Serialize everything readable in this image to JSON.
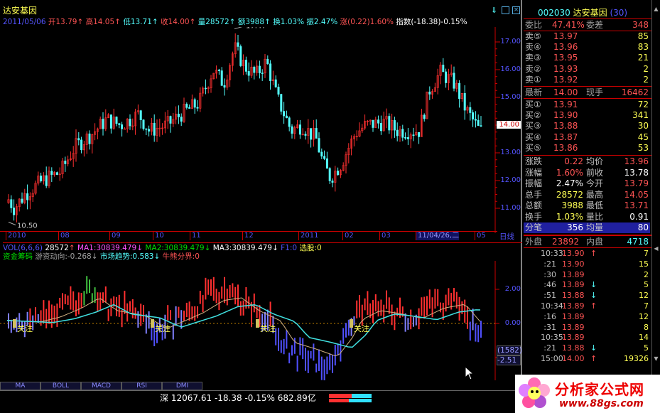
{
  "stock": {
    "name": "达安基因",
    "code": "002030",
    "badge": "(30)",
    "date": "2011/05/06",
    "open_label": "开",
    "open": "13.79",
    "high_label": "高",
    "high": "14.05",
    "low_label": "低",
    "low": "13.71",
    "close_label": "收",
    "close": "14.00",
    "vol_label": "量",
    "vol": "28572",
    "amt_label": "额",
    "amt": "3988",
    "turn_label": "换",
    "turn": "1.03%",
    "amp_label": "振",
    "amp": "2.47%",
    "chg_label": "涨",
    "chg": "(0.22)1.60%",
    "idx_label": "指数",
    "idx": "(-18.38)-0.15%"
  },
  "price_axis": [
    "17.00",
    "16.00",
    "15.00",
    "14.00",
    "13.00",
    "12.00",
    "11.00"
  ],
  "current_price_tag": "14.00",
  "peak_label": "17.47",
  "trough_label": "10.50",
  "date_axis": [
    "2010",
    "08",
    "09",
    "10",
    "11",
    "12",
    "2011",
    "02",
    "03",
    "11/04/26,二",
    "05"
  ],
  "period_label": "日线",
  "vol_line": {
    "name": "VOL(6,6,6)",
    "vol": "28572",
    "ma1_label": "MA1:30839.479",
    "ma2_label": "MA2:30839.479",
    "ma3_label": "MA3:30839.479",
    "f1": "F1:0",
    "pick": "选股:0"
  },
  "indicator": {
    "name": "资金筹码",
    "l1": "游资动向:-0.268",
    "l2": "市场趋势:0.583",
    "l3": "牛熊分界:0",
    "axis": [
      "2.00",
      "0.00",
      "-2.00"
    ],
    "focus": "关注",
    "box1": "(1582)",
    "box2": "-2.51"
  },
  "tabs": [
    "MA",
    "BOLL",
    "MACD",
    "RSI",
    "DMI"
  ],
  "status": {
    "market": "深",
    "index": "12067.61",
    "chg": "-18.38",
    "pct": "-0.15%",
    "amt": "682.89亿"
  },
  "order_book": {
    "ratio_label": "委比",
    "ratio": "47.41%",
    "diff_label": "委差",
    "diff": "348",
    "asks": [
      {
        "label": "卖⑤",
        "price": "13.97",
        "vol": "85"
      },
      {
        "label": "卖④",
        "price": "13.96",
        "vol": "83"
      },
      {
        "label": "卖③",
        "price": "13.95",
        "vol": "21"
      },
      {
        "label": "卖②",
        "price": "13.93",
        "vol": "2"
      },
      {
        "label": "卖①",
        "price": "13.92",
        "vol": "2"
      }
    ],
    "last_label": "最新",
    "last": "14.00",
    "hand_label": "现手",
    "hand": "16462",
    "bids": [
      {
        "label": "买①",
        "price": "13.91",
        "vol": "72"
      },
      {
        "label": "买②",
        "price": "13.90",
        "vol": "341"
      },
      {
        "label": "买③",
        "price": "13.88",
        "vol": "30"
      },
      {
        "label": "买④",
        "price": "13.87",
        "vol": "45"
      },
      {
        "label": "买⑤",
        "price": "13.86",
        "vol": "53"
      }
    ]
  },
  "stats": [
    {
      "l1": "涨跌",
      "v1": "0.22",
      "l2": "均价",
      "v2": "13.96"
    },
    {
      "l1": "涨幅",
      "v1": "1.60%",
      "l2": "前收",
      "v2": "13.78"
    },
    {
      "l1": "振幅",
      "v1": "2.47%",
      "l2": "今开",
      "v2": "13.79"
    },
    {
      "l1": "总手",
      "v1": "28572",
      "l2": "最高",
      "v2": "14.05"
    },
    {
      "l1": "总额",
      "v1": "3988",
      "l2": "最低",
      "v2": "13.71"
    },
    {
      "l1": "换手",
      "v1": "1.03%",
      "l2": "量比",
      "v2": "0.91"
    },
    {
      "l1": "分笔",
      "v1": "356",
      "l2": "均量",
      "v2": "80"
    }
  ],
  "outer": {
    "l1": "外盘",
    "v1": "23892",
    "l2": "内盘",
    "v2": "4718"
  },
  "ticks": [
    {
      "time": "10:33",
      "price": "13.90",
      "arrow": "↑",
      "vol": "7"
    },
    {
      "time": ":21",
      "price": "13.90",
      "arrow": "",
      "vol": "15"
    },
    {
      "time": ":30",
      "price": "13.89",
      "arrow": "",
      "vol": "2"
    },
    {
      "time": ":46",
      "price": "13.89",
      "arrow": "↓",
      "vol": "5"
    },
    {
      "time": ":51",
      "price": "13.88",
      "arrow": "↓",
      "vol": "12"
    },
    {
      "time": "10:34",
      "price": "13.89",
      "arrow": "↑",
      "vol": "7"
    },
    {
      "time": ":16",
      "price": "13.89",
      "arrow": "",
      "vol": "12"
    },
    {
      "time": ":31",
      "price": "13.89",
      "arrow": "",
      "vol": "8"
    },
    {
      "time": "10:35",
      "price": "13.89",
      "arrow": "",
      "vol": "14"
    },
    {
      "time": ":21",
      "price": "13.88",
      "arrow": "↓",
      "vol": "5"
    },
    {
      "time": "15:00",
      "price": "14.00",
      "arrow": "↑",
      "vol": "19326"
    }
  ],
  "logo": {
    "name": "分析家公式网",
    "url": "www.88gs.com"
  }
}
